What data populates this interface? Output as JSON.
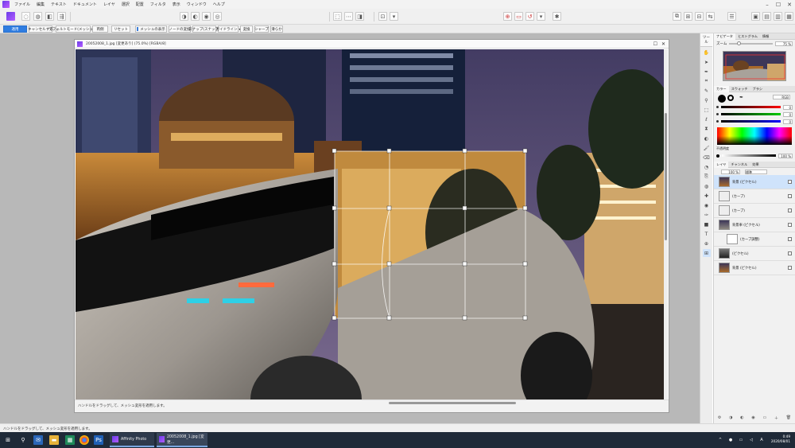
{
  "menu": [
    "ファイル",
    "編集",
    "テキスト",
    "ドキュメント",
    "レイヤ",
    "選択",
    "配置",
    "フィルタ",
    "表示",
    "ウィンドウ",
    "ヘルプ"
  ],
  "context_bar": {
    "apply": "適用",
    "cancel": "キャンセルする",
    "distort_mode": "デフォルトモード(メッシュ)",
    "mirror": "両側",
    "reset": "リセット",
    "show_mesh": "メッシュの表示",
    "node_convert": "ノードの変換",
    "snapping": "スナップ(スナップ)",
    "snap_mode": "ガイドライン",
    "convert": "変換",
    "sharp": "シャープ",
    "smooth": "滑らか"
  },
  "document": {
    "title": "20052008_1.jpg [変更あり] (75.0%) [RGBA/8]",
    "status": "ハンドルをドラッグして、メッシュ変形を適用します。"
  },
  "tools_panel": {
    "tab": "ツール"
  },
  "navigator": {
    "tabs": [
      "ナビゲータ",
      "ヒストグラム",
      "情報"
    ],
    "zoom_label": "ズーム",
    "zoom_value": "75 %"
  },
  "color": {
    "tabs": [
      "カラー",
      "スウォッチ",
      "ブラシ"
    ],
    "mode": "RGB",
    "r": "0",
    "g": "0",
    "b": "0",
    "opacity_label": "不透明度",
    "opacity_value": "100 %"
  },
  "layers": {
    "tabs": [
      "レイヤ",
      "チャンネル",
      "効果"
    ],
    "opacity": "100 %",
    "blend": "標準",
    "items": [
      {
        "name": "背景 (ピクセル)",
        "selected": true
      },
      {
        "name": "(カーブ)",
        "selected": false
      },
      {
        "name": "(カーブ)",
        "selected": false
      },
      {
        "name": "背景車 (ピクセル)",
        "selected": false
      },
      {
        "name": "(カーブ調整)",
        "selected": false
      },
      {
        "name": "(ピクセル)",
        "selected": false
      },
      {
        "name": "背景 (ピクセル)",
        "selected": false
      }
    ]
  },
  "app_status": "ハンドルをドラッグして、メッシュ変形を適用します。",
  "taskbar": {
    "app1": "Affinity Photo",
    "app2": "20052008_1.jpg [変更...",
    "time": "0:49",
    "date": "2020/08/01"
  },
  "colors": {
    "accent": "#2f7de1",
    "taskbar": "#1f2a38",
    "workspace": "#b8b8b8",
    "selected_layer": "#cfe3fb"
  }
}
